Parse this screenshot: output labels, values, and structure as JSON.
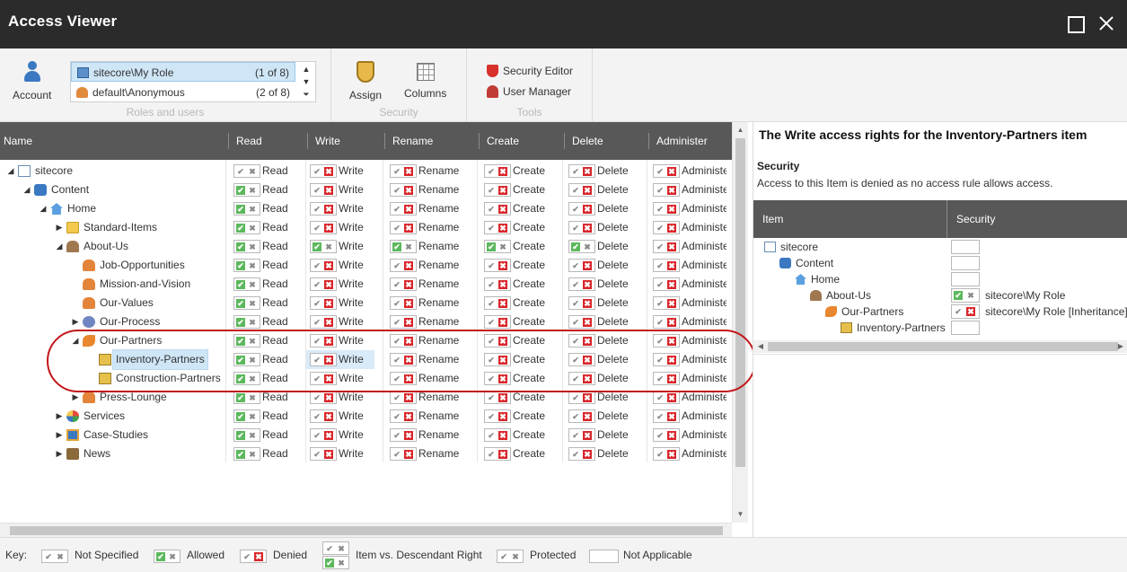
{
  "window": {
    "title": "Access Viewer"
  },
  "ribbon": {
    "account_label": "Account",
    "roles": [
      {
        "name": "sitecore\\My Role",
        "count": "(1 of 8)",
        "selected": true
      },
      {
        "name": "default\\Anonymous",
        "count": "(2 of 8)",
        "selected": false
      }
    ],
    "group_roles": "Roles and users",
    "assign_label": "Assign",
    "columns_label": "Columns",
    "group_security": "Security",
    "security_editor_label": "Security Editor",
    "user_manager_label": "User Manager",
    "group_tools": "Tools"
  },
  "grid": {
    "columns": [
      "Name",
      "Read",
      "Write",
      "Rename",
      "Create",
      "Delete",
      "Administer"
    ],
    "rows": [
      {
        "name": "sitecore",
        "level": 0,
        "toggle": "expanded",
        "icon": "document-icon",
        "perms": [
          "XX",
          "XD",
          "XD",
          "XD",
          "XD",
          "XD"
        ]
      },
      {
        "name": "Content",
        "level": 1,
        "toggle": "expanded",
        "icon": "content-icon",
        "perms": [
          "AX",
          "XD",
          "XD",
          "XD",
          "XD",
          "XD"
        ]
      },
      {
        "name": "Home",
        "level": 2,
        "toggle": "expanded",
        "icon": "home-icon",
        "perms": [
          "AX",
          "XD",
          "XD",
          "XD",
          "XD",
          "XD"
        ]
      },
      {
        "name": "Standard-Items",
        "level": 3,
        "toggle": "collapsed",
        "icon": "folder-icon",
        "perms": [
          "AX",
          "XD",
          "XD",
          "XD",
          "XD",
          "XD"
        ]
      },
      {
        "name": "About-Us",
        "level": 3,
        "toggle": "expanded",
        "icon": "about-icon",
        "perms": [
          "AX",
          "AX",
          "AX",
          "AX",
          "AX",
          "XD"
        ]
      },
      {
        "name": "Job-Opportunities",
        "level": 4,
        "toggle": "none",
        "icon": "people-icon",
        "perms": [
          "AX",
          "XD",
          "XD",
          "XD",
          "XD",
          "XD"
        ]
      },
      {
        "name": "Mission-and-Vision",
        "level": 4,
        "toggle": "none",
        "icon": "people-icon",
        "perms": [
          "AX",
          "XD",
          "XD",
          "XD",
          "XD",
          "XD"
        ]
      },
      {
        "name": "Our-Values",
        "level": 4,
        "toggle": "none",
        "icon": "people-icon",
        "perms": [
          "AX",
          "XD",
          "XD",
          "XD",
          "XD",
          "XD"
        ]
      },
      {
        "name": "Our-Process",
        "level": 4,
        "toggle": "collapsed",
        "icon": "gear-icon",
        "perms": [
          "AX",
          "XD",
          "XD",
          "XD",
          "XD",
          "XD"
        ]
      },
      {
        "name": "Our-Partners",
        "level": 4,
        "toggle": "expanded",
        "icon": "handshake-icon",
        "perms": [
          "AX",
          "XD",
          "XD",
          "XD",
          "XD",
          "XD"
        ]
      },
      {
        "name": "Inventory-Partners",
        "level": 5,
        "toggle": "none",
        "icon": "building-icon",
        "selected": true,
        "perms": [
          "AX",
          "XD",
          "XD",
          "XD",
          "XD",
          "XD"
        ]
      },
      {
        "name": "Construction-Partners",
        "level": 5,
        "toggle": "none",
        "icon": "building-icon",
        "perms": [
          "AX",
          "XD",
          "XD",
          "XD",
          "XD",
          "XD"
        ]
      },
      {
        "name": "Press-Lounge",
        "level": 4,
        "toggle": "collapsed",
        "icon": "people-icon",
        "perms": [
          "AX",
          "XD",
          "XD",
          "XD",
          "XD",
          "XD"
        ]
      },
      {
        "name": "Services",
        "level": 3,
        "toggle": "collapsed",
        "icon": "services-icon",
        "perms": [
          "AX",
          "XD",
          "XD",
          "XD",
          "XD",
          "XD"
        ]
      },
      {
        "name": "Case-Studies",
        "level": 3,
        "toggle": "collapsed",
        "icon": "case-studies-icon",
        "perms": [
          "AX",
          "XD",
          "XD",
          "XD",
          "XD",
          "XD"
        ]
      },
      {
        "name": "News",
        "level": 3,
        "toggle": "collapsed",
        "icon": "news-icon",
        "perms": [
          "AX",
          "XD",
          "XD",
          "XD",
          "XD",
          "XD"
        ]
      }
    ],
    "perm_labels": [
      "Read",
      "Write",
      "Rename",
      "Create",
      "Delete",
      "Administer"
    ],
    "highlight": {
      "row": 10,
      "col": 1
    }
  },
  "details": {
    "title": "The Write access rights for the Inventory-Partners item",
    "section": "Security",
    "description": "Access to this Item is denied as no access rule allows access.",
    "col_item": "Item",
    "col_security": "Security",
    "rows": [
      {
        "name": "sitecore",
        "icon": "document-icon",
        "level": 0,
        "box": "",
        "role": ""
      },
      {
        "name": "Content",
        "icon": "content-icon",
        "level": 1,
        "box": "",
        "role": ""
      },
      {
        "name": "Home",
        "icon": "home-icon",
        "level": 2,
        "box": "",
        "role": ""
      },
      {
        "name": "About-Us",
        "icon": "about-icon",
        "level": 3,
        "box": "AX",
        "role": "sitecore\\My Role"
      },
      {
        "name": "Our-Partners",
        "icon": "handshake-icon",
        "level": 4,
        "box": "XD",
        "role": "sitecore\\My Role [Inheritance]"
      },
      {
        "name": "Inventory-Partners",
        "icon": "building-icon",
        "level": 5,
        "box": "",
        "role": ""
      }
    ]
  },
  "key": {
    "label": "Key:",
    "not_specified": "Not Specified",
    "allowed": "Allowed",
    "denied": "Denied",
    "item_vs_descendant": "Item vs. Descendant Right",
    "protected": "Protected",
    "not_applicable": "Not Applicable"
  },
  "colors": {
    "titlebar": "#2b2b2b",
    "header": "#585858",
    "allowed": "#5cb85c",
    "denied": "#d9262b",
    "highlight_oval": "#c2161b",
    "selection": "#cfe6f7"
  }
}
